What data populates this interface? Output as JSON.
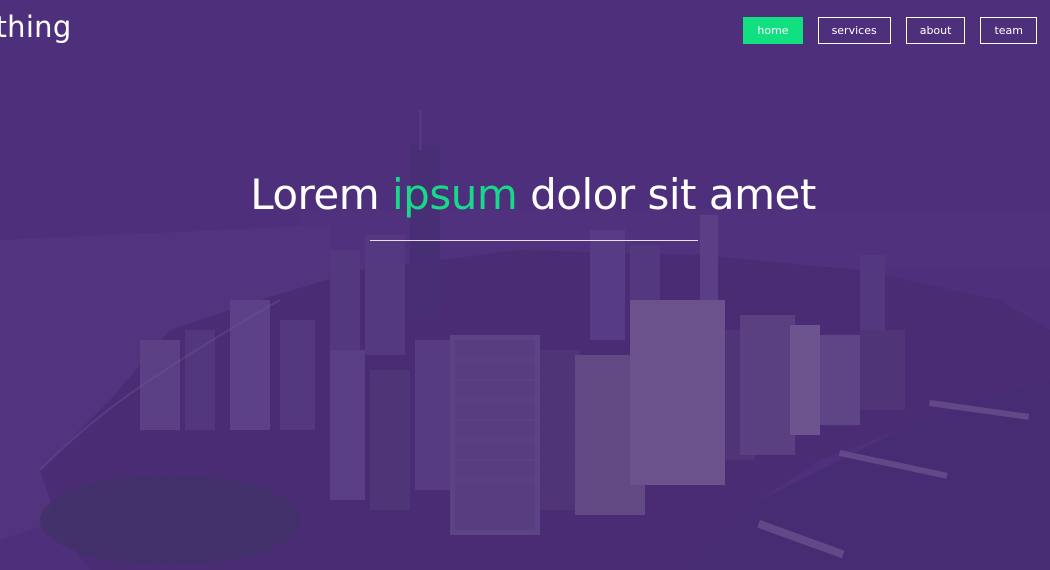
{
  "brand": {
    "title": "ything"
  },
  "nav": {
    "items": [
      {
        "label": "home",
        "active": true
      },
      {
        "label": "services",
        "active": false
      },
      {
        "label": "about",
        "active": false
      },
      {
        "label": "team",
        "active": false
      }
    ]
  },
  "hero": {
    "headline_before": "Lorem ",
    "headline_accent": "ipsum",
    "headline_after": " dolor sit amet",
    "background": "city-skyline-aerial-image"
  },
  "colors": {
    "overlay": "#4a2f78",
    "accent": "#10e07f",
    "text": "#ffffff"
  }
}
